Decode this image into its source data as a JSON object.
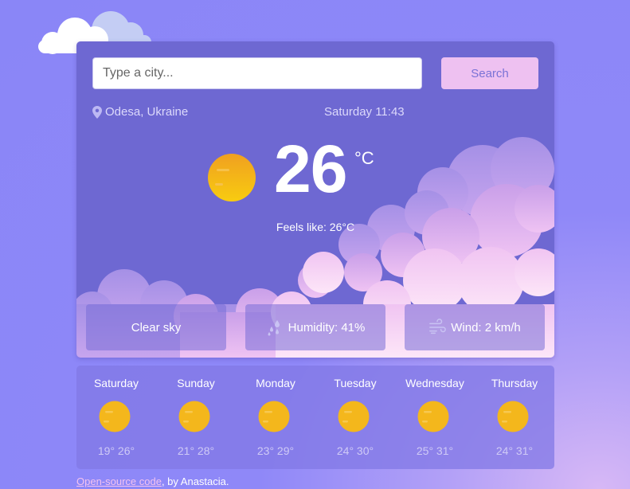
{
  "search": {
    "placeholder": "Type a city...",
    "value": "",
    "button_label": "Search"
  },
  "location": {
    "icon": "location-pin-icon",
    "text": "Odesa, Ukraine"
  },
  "datetime": "Saturday 11:43",
  "current": {
    "temperature": "26",
    "unit": "°C",
    "feels_like": "Feels like: 26°C",
    "icon": "sun-icon"
  },
  "tiles": {
    "description": "Clear sky",
    "humidity": "Humidity: 41%",
    "wind": "Wind: 2 km/h"
  },
  "forecast": [
    {
      "day": "Saturday",
      "temps": "19° 26°"
    },
    {
      "day": "Sunday",
      "temps": "21° 28°"
    },
    {
      "day": "Monday",
      "temps": "23° 29°"
    },
    {
      "day": "Tuesday",
      "temps": "24° 30°"
    },
    {
      "day": "Wednesday",
      "temps": "25° 31°"
    },
    {
      "day": "Thursday",
      "temps": "24° 31°"
    }
  ],
  "footer": {
    "link_text": "Open-source code",
    "suffix": ", by Anastacia."
  },
  "colors": {
    "background": "#8a86f7",
    "card": "#6e68d2",
    "button": "#eec1f1",
    "sun": "#f5b800"
  }
}
